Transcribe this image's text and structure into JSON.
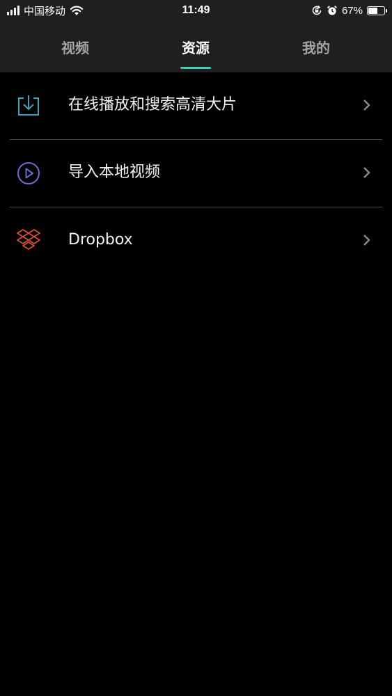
{
  "status_bar": {
    "carrier": "中国移动",
    "time": "11:49",
    "battery_percent_label": "67%",
    "battery_level": 0.67,
    "icons": [
      "signal-icon",
      "wifi-icon",
      "orientation-lock-icon",
      "alarm-icon",
      "battery-icon"
    ]
  },
  "tabs": [
    {
      "label": "视频",
      "active": false
    },
    {
      "label": "资源",
      "active": true
    },
    {
      "label": "我的",
      "active": false
    }
  ],
  "accent_color": "#3fd1b0",
  "list": [
    {
      "label": "在线播放和搜索高清大片",
      "icon": "download-icon",
      "icon_color": "#3fa2b8"
    },
    {
      "label": "导入本地视频",
      "icon": "play-circle-icon",
      "icon_color": "#6b6bd6"
    },
    {
      "label": "Dropbox",
      "icon": "dropbox-icon",
      "icon_color": "#d4502c"
    }
  ]
}
